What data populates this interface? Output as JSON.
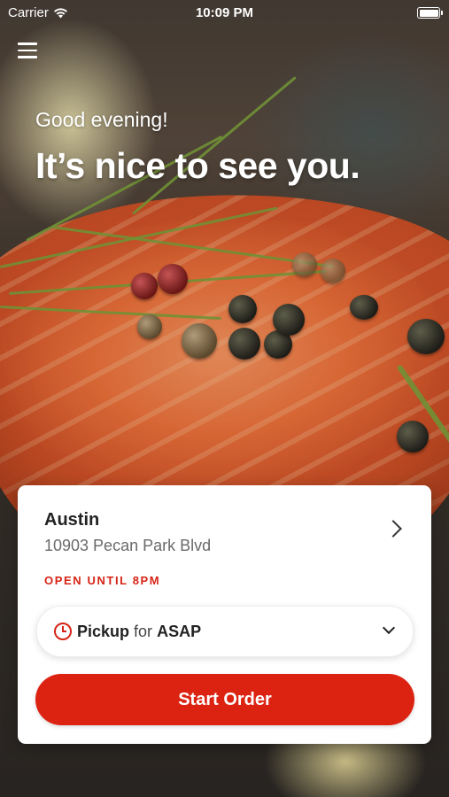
{
  "status_bar": {
    "carrier": "Carrier",
    "time": "10:09 PM"
  },
  "hero": {
    "greeting": "Good evening!",
    "headline": "It’s nice to see you."
  },
  "location": {
    "name": "Austin",
    "address": "10903 Pecan Park Blvd",
    "hours_status": "OPEN UNTIL 8PM"
  },
  "order_type": {
    "mode": "Pickup",
    "connector": "for",
    "time": "ASAP"
  },
  "actions": {
    "start_order_label": "Start Order"
  },
  "colors": {
    "accent": "#dc2312",
    "text_primary": "#222222",
    "text_secondary": "#6a6a6a"
  },
  "icons": [
    "wifi-icon",
    "battery-icon",
    "menu-icon",
    "chevron-right-icon",
    "clock-icon",
    "chevron-down-icon"
  ]
}
